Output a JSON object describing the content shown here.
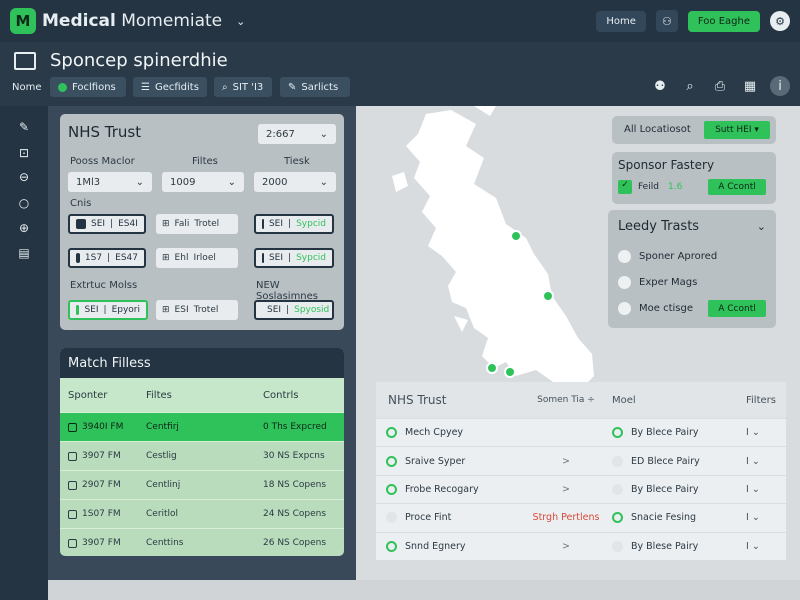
{
  "app": {
    "logo": "M",
    "title_bold": "Medical",
    "title_rest": " Momemiate"
  },
  "topbar": {
    "home_btn": "Home",
    "cta_btn": "Foo Eaghe"
  },
  "subbar": {
    "page_title": "Sponcep spinerdhie",
    "home_label": "Nome",
    "chips": [
      "Foclfions",
      "Gecfidits",
      "SIT 'I3",
      "Sarlicts"
    ]
  },
  "nhs_panel": {
    "title": "NHS Trust",
    "top_select": "2:667",
    "labels": [
      "Pooss Maclor",
      "Filtes",
      "Tiesk"
    ],
    "selects": [
      "1Ml3",
      "1009",
      "2000"
    ],
    "section_a": "Cnis",
    "section_b": "Extrtuc Molss",
    "section_c": "NEW Soslasimnes",
    "tags_row1": [
      {
        "a": "SEI",
        "b": "ES4I"
      },
      {
        "a": "Fali",
        "b": "Trotel"
      },
      {
        "a": "SEI",
        "b": "Sypcid"
      }
    ],
    "tags_row2": [
      {
        "a": "1S7",
        "b": "ES47"
      },
      {
        "a": "Ehl",
        "b": "Irloel"
      },
      {
        "a": "SEI",
        "b": "Sypcid"
      }
    ],
    "tags_row3": [
      {
        "a": "SEI",
        "b": "Epyori"
      },
      {
        "a": "ESI",
        "b": "Trotel"
      },
      {
        "a": "SEI",
        "b": "Spyosid"
      }
    ]
  },
  "match_filters": {
    "title": "Match Filless",
    "columns": [
      "Sponter",
      "Filtes",
      "Contrls"
    ],
    "rows": [
      {
        "time": "3940I FM",
        "status": "Centfirj",
        "info": "0  Ths Expcred",
        "selected": true
      },
      {
        "time": "3907 FM",
        "status": "Cestlig",
        "info": "30 NS Expcns",
        "selected": false
      },
      {
        "time": "2907 FM",
        "status": "Centlinj",
        "info": "18 NS Copens",
        "selected": false
      },
      {
        "time": "1S07 FM",
        "status": "Ceritlol",
        "info": "24 NS Copens",
        "selected": false
      },
      {
        "time": "3907 FM",
        "status": "Centtins",
        "info": "26 NS Copens",
        "selected": false
      }
    ]
  },
  "right": {
    "loc_label": "All Locatiosot",
    "loc_btn": "Sutt HEI ▾",
    "factory_title": "Sponsor Fastery",
    "factory_item": "Feild",
    "factory_item_num": "1.6",
    "factory_btn": "A Ccontl",
    "trusts_title": "Leedy Trasts",
    "trusts_options": [
      "Sponer Aprored",
      "Exper Mags",
      "Moe ctisge"
    ],
    "trusts_btn": "A Ccontl"
  },
  "table": {
    "columns": [
      "NHS Trust",
      "Somen Tia ÷",
      "Moel",
      "Filters"
    ],
    "rows": [
      {
        "name": "Mech Cpyey",
        "mid": "",
        "field": "By Blece Pairy",
        "end": "I",
        "name_dot": true,
        "field_dot": true,
        "red": false
      },
      {
        "name": "Sraive Syper",
        "mid": ">",
        "field": "ED Blece Pairy",
        "end": "I",
        "name_dot": true,
        "field_dot": false,
        "red": false
      },
      {
        "name": "Frobe Recogary",
        "mid": ">",
        "field": "By Blece Pairy",
        "end": "I",
        "name_dot": true,
        "field_dot": false,
        "red": false
      },
      {
        "name": "Proce Fint",
        "mid": "Strgh Pertlens",
        "field": "Snacie Fesing",
        "end": "I",
        "name_dot": false,
        "field_dot": true,
        "red": true
      },
      {
        "name": "Snnd Egnery",
        "mid": ">",
        "field": "By Blese Pairy",
        "end": "I",
        "name_dot": true,
        "field_dot": false,
        "red": false
      }
    ]
  },
  "colors": {
    "accent": "#2fc25b",
    "dark": "#243442",
    "panel": "#b9c0c4",
    "alert": "#d84a3a"
  }
}
